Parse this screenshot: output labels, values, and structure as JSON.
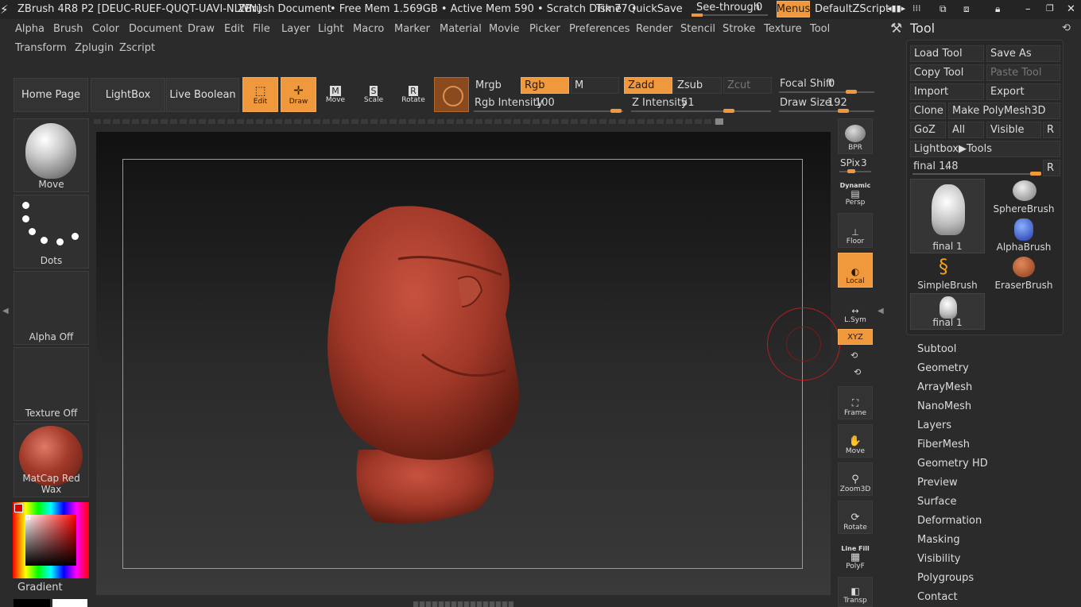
{
  "titlebar": {
    "app": "ZBrush 4R8 P2 [DEUC-RUEF-QUQT-UAVI-NLWN]",
    "doc": "ZBrush Document",
    "mem": "• Free Mem 1.569GB • Active Mem 590 • Scratch Disk 77 •",
    "time": "Time",
    "quicksave": "QuickSave",
    "seethrough": "See-through",
    "seethrough_val": "0",
    "menus": "Menus",
    "zscript": "DefaultZScript"
  },
  "menu_row1": [
    "Alpha",
    "Brush",
    "Color",
    "Document",
    "Draw",
    "Edit",
    "File",
    "Layer",
    "Light",
    "Macro",
    "Marker",
    "Material",
    "Movie",
    "Picker",
    "Preferences",
    "Render",
    "Stencil",
    "Stroke",
    "Texture",
    "Tool"
  ],
  "menu_row2": [
    "Transform",
    "Zplugin",
    "Zscript"
  ],
  "toolbar": {
    "home": "Home Page",
    "lightbox": "LightBox",
    "live_boolean": "Live Boolean",
    "edit": "Edit",
    "draw": "Draw",
    "move": "Move",
    "scale": "Scale",
    "rotate": "Rotate",
    "mrgb": "Mrgb",
    "rgb": "Rgb",
    "m": "M",
    "zadd": "Zadd",
    "zsub": "Zsub",
    "zcut": "Zcut",
    "rgb_intensity_label": "Rgb Intensity",
    "rgb_intensity": "100",
    "z_intensity_label": "Z Intensity",
    "z_intensity": "51",
    "focal_shift_label": "Focal Shift",
    "focal_shift": "0",
    "draw_size_label": "Draw Size",
    "draw_size": "192"
  },
  "left_panel": {
    "brush": "Move",
    "stroke": "Dots",
    "alpha": "Alpha Off",
    "texture": "Texture Off",
    "material": "MatCap Red Wax",
    "gradient": "Gradient"
  },
  "right_shelf": {
    "bpr": "BPR",
    "spix_label": "SPix",
    "spix": "3",
    "dynamic": "Dynamic",
    "persp": "Persp",
    "floor": "Floor",
    "local": "Local",
    "lsym": "L.Sym",
    "xyz": "XYZ",
    "frame": "Frame",
    "move": "Move",
    "zoom3d": "Zoom3D",
    "rotate": "Rotate",
    "linefill": "Line Fill",
    "polyf": "PolyF",
    "transp": "Transp"
  },
  "tool_panel": {
    "title": "Tool",
    "load_tool": "Load Tool",
    "save_as": "Save As",
    "copy_tool": "Copy Tool",
    "paste_tool": "Paste Tool",
    "import": "Import",
    "export": "Export",
    "clone": "Clone",
    "make_polymesh": "Make PolyMesh3D",
    "goz": "GoZ",
    "all": "All",
    "visible": "Visible",
    "r": "R",
    "lightbox_tools": "Lightbox▶Tools",
    "current_tool_label": "final 1.",
    "current_tool_val": "48",
    "thumbs": [
      "final 1",
      "SphereBrush",
      "AlphaBrush",
      "SimpleBrush",
      "EraserBrush",
      "final 1"
    ],
    "sections": [
      "Subtool",
      "Geometry",
      "ArrayMesh",
      "NanoMesh",
      "Layers",
      "FiberMesh",
      "Geometry HD",
      "Preview",
      "Surface",
      "Deformation",
      "Masking",
      "Visibility",
      "Polygroups",
      "Contact"
    ]
  },
  "colors": {
    "accent": "#f0983c",
    "model": "#a83a2c",
    "canvas": "#242424"
  }
}
